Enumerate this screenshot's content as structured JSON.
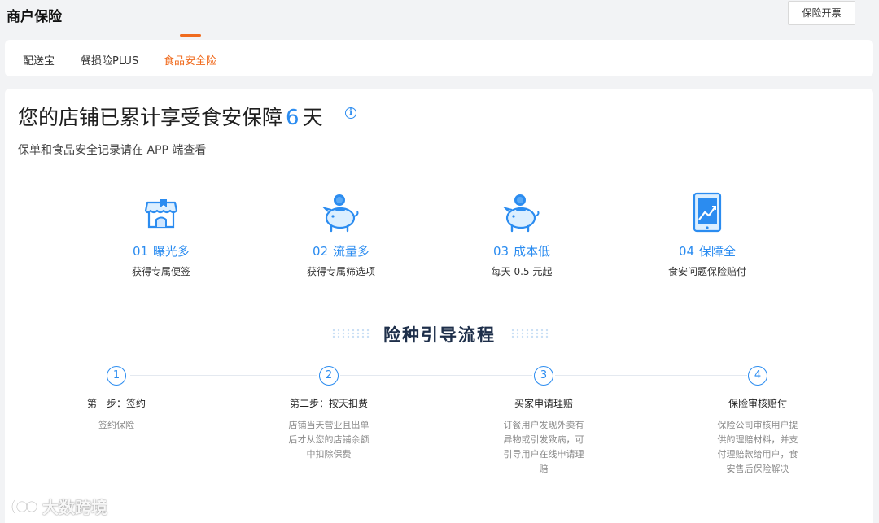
{
  "header": {
    "title": "商户保险",
    "invoice_button": "保险开票"
  },
  "tabs": [
    {
      "label": "配送宝",
      "active": false
    },
    {
      "label": "餐损险PLUS",
      "active": false
    },
    {
      "label": "食品安全险",
      "active": true
    }
  ],
  "summary": {
    "headline_prefix": "您的店铺已累计享受食安保障",
    "days": "6",
    "headline_suffix": "天",
    "subtitle": "保单和食品安全记录请在 APP 端查看"
  },
  "benefits": [
    {
      "num": "01",
      "title": "曝光多",
      "desc": "获得专属便签",
      "icon": "shop-icon"
    },
    {
      "num": "02",
      "title": "流量多",
      "desc": "获得专属筛选项",
      "icon": "piggy-bank-icon"
    },
    {
      "num": "03",
      "title": "成本低",
      "desc": "每天 0.5 元起",
      "icon": "piggy-bank-icon"
    },
    {
      "num": "04",
      "title": "保障全",
      "desc": "食安问题保险赔付",
      "icon": "tablet-chart-icon"
    }
  ],
  "flow": {
    "title": "险种引导流程",
    "steps": [
      {
        "num": "1",
        "title": "第一步：签约",
        "desc": "签约保险"
      },
      {
        "num": "2",
        "title": "第二步：按天扣费",
        "desc": "店铺当天营业且出单后才从您的店铺余额中扣除保费"
      },
      {
        "num": "3",
        "title": "买家申请理赔",
        "desc": "订餐用户发现外卖有异物或引发致病，可引导用户在线申请理赔"
      },
      {
        "num": "4",
        "title": "保险审核赔付",
        "desc": "保险公司审核用户提供的理赔材料，并支付理赔款给用户，食安售后保险解决"
      }
    ]
  },
  "watermark": "大数跨境",
  "colors": {
    "accent_blue": "#2b8cf0",
    "tab_active": "#f06b1e",
    "flow_title": "#1e2f4a"
  }
}
